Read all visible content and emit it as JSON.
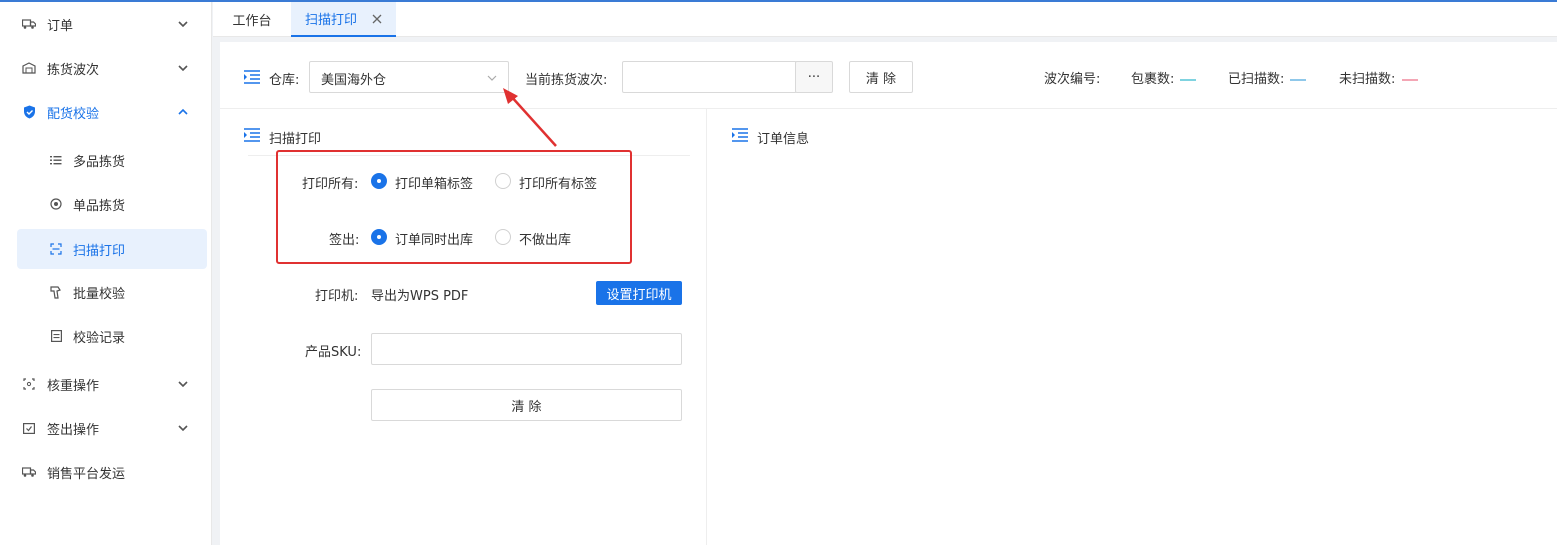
{
  "sidebar": {
    "items": [
      {
        "label": "订单",
        "icon": "truck-icon"
      },
      {
        "label": "拣货波次",
        "icon": "warehouse-icon"
      },
      {
        "label": "配货校验",
        "icon": "shield-check-icon"
      },
      {
        "label": "多品拣货",
        "icon": "list-icon"
      },
      {
        "label": "单品拣货",
        "icon": "target-icon"
      },
      {
        "label": "扫描打印",
        "icon": "scan-icon"
      },
      {
        "label": "批量校验",
        "icon": "barcode-gun-icon"
      },
      {
        "label": "校验记录",
        "icon": "record-icon"
      },
      {
        "label": "核重操作",
        "icon": "scale-icon"
      },
      {
        "label": "签出操作",
        "icon": "checkout-icon"
      },
      {
        "label": "销售平台发运",
        "icon": "delivery-icon"
      }
    ]
  },
  "tabs": {
    "items": [
      {
        "label": "工作台"
      },
      {
        "label": "扫描打印"
      }
    ]
  },
  "toolbar": {
    "warehouse_label": "仓库:",
    "warehouse_value": "美国海外仓",
    "wave_label": "当前拣货波次:",
    "wave_value": "",
    "ellipsis": "···",
    "clear_label": "清 除",
    "wave_no_label": "波次编号:",
    "package_count_label": "包裹数:",
    "scanned_label": "已扫描数:",
    "unscanned_label": "未扫描数:"
  },
  "scan_panel": {
    "title": "扫描打印",
    "print_all_label": "打印所有:",
    "print_options": [
      "打印单箱标签",
      "打印所有标签"
    ],
    "checkout_label": "签出:",
    "checkout_options": [
      "订单同时出库",
      "不做出库"
    ],
    "printer_label": "打印机:",
    "printer_value": "导出为WPS PDF",
    "set_printer_button": "设置打印机",
    "sku_label": "产品SKU:",
    "sku_value": "",
    "clear_button": "清 除"
  },
  "order_panel": {
    "title": "订单信息"
  },
  "colors": {
    "accent": "#1a73e8",
    "highlight": "#e03131",
    "package_dash": "#7fd3e0",
    "scanned_dash": "#8fc8ea",
    "unscanned_dash": "#f4a6b5"
  }
}
